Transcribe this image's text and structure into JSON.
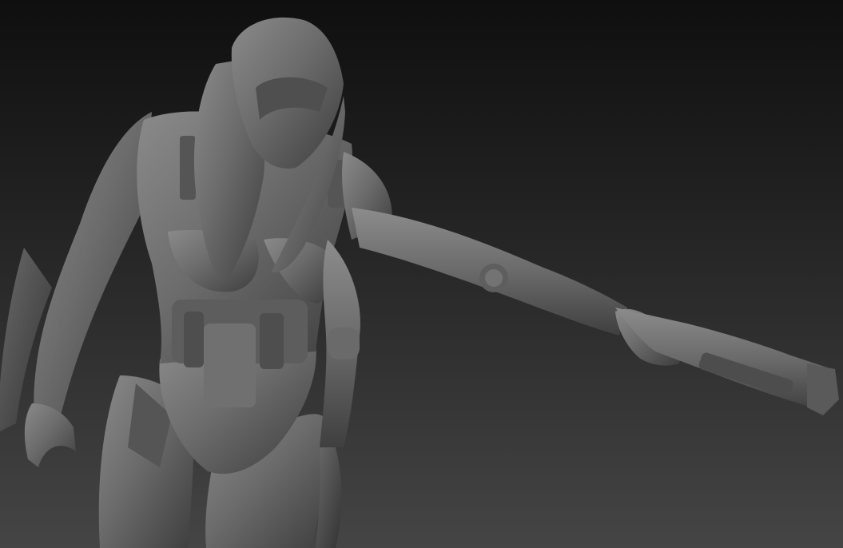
{
  "viewport": {
    "background_top": "#0f0f0f",
    "background_bottom": "#454545",
    "material_color": "#6e6e6e"
  },
  "model": {
    "subject": "armored-female-figure-with-pistol",
    "parts": [
      "helmet",
      "torso",
      "chest-plate",
      "harness",
      "left-arm",
      "right-arm",
      "hand",
      "pistol",
      "hips",
      "legs"
    ]
  }
}
